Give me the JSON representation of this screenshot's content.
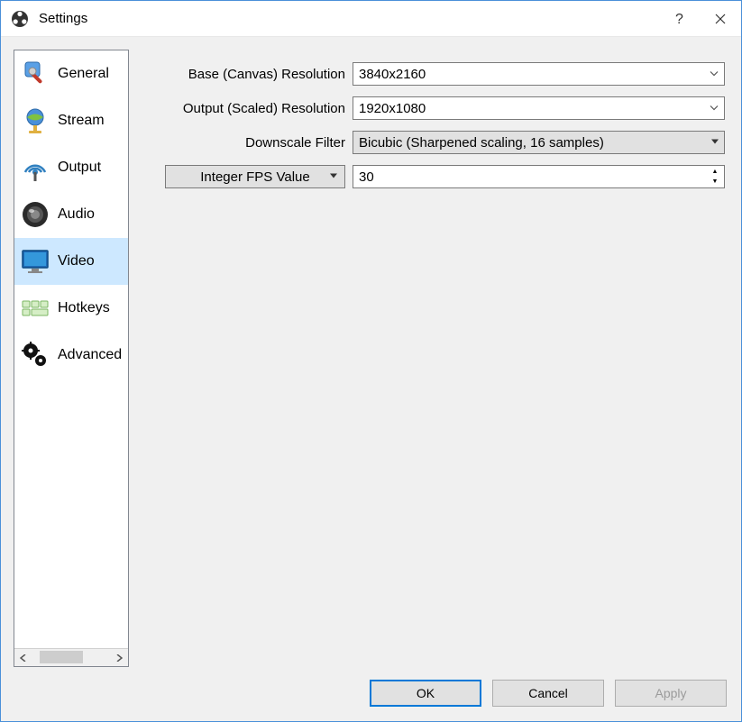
{
  "window": {
    "title": "Settings"
  },
  "sidebar": {
    "items": [
      {
        "label": "General"
      },
      {
        "label": "Stream"
      },
      {
        "label": "Output"
      },
      {
        "label": "Audio"
      },
      {
        "label": "Video"
      },
      {
        "label": "Hotkeys"
      },
      {
        "label": "Advanced"
      }
    ]
  },
  "video": {
    "base_label": "Base (Canvas) Resolution",
    "base_value": "3840x2160",
    "output_label": "Output (Scaled) Resolution",
    "output_value": "1920x1080",
    "filter_label": "Downscale Filter",
    "filter_value": "Bicubic (Sharpened scaling, 16 samples)",
    "fps_type_label": "Integer FPS Value",
    "fps_value": "30"
  },
  "buttons": {
    "ok": "OK",
    "cancel": "Cancel",
    "apply": "Apply"
  }
}
